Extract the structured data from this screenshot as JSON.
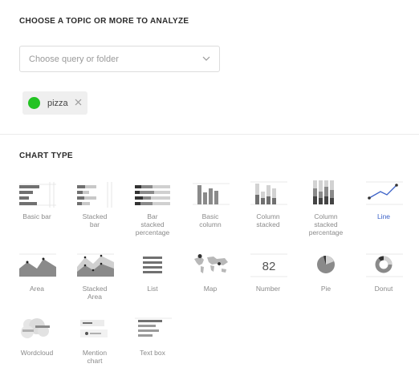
{
  "topic_section": {
    "title": "CHOOSE A TOPIC OR MORE TO ANALYZE",
    "select_placeholder": "Choose query or folder",
    "tags": [
      {
        "label": "pizza",
        "color": "#22c322"
      }
    ]
  },
  "chart_section": {
    "title": "CHART TYPE",
    "types": [
      {
        "label": "Basic bar",
        "icon": "basic-bar-icon"
      },
      {
        "label": "Stacked\nbar",
        "icon": "stacked-bar-icon"
      },
      {
        "label": "Bar\nstacked\npercentage",
        "icon": "bar-stacked-percentage-icon"
      },
      {
        "label": "Basic\ncolumn",
        "icon": "basic-column-icon"
      },
      {
        "label": "Column\nstacked",
        "icon": "column-stacked-icon"
      },
      {
        "label": "Column\nstacked\npercentage",
        "icon": "column-stacked-percentage-icon"
      },
      {
        "label": "Line",
        "icon": "line-icon",
        "selected": true
      },
      {
        "label": "Area",
        "icon": "area-icon"
      },
      {
        "label": "Stacked\nArea",
        "icon": "stacked-area-icon"
      },
      {
        "label": "List",
        "icon": "list-icon"
      },
      {
        "label": "Map",
        "icon": "map-icon"
      },
      {
        "label": "Number",
        "icon": "number-icon",
        "icon_text": "82"
      },
      {
        "label": "Pie",
        "icon": "pie-icon"
      },
      {
        "label": "Donut",
        "icon": "donut-icon"
      },
      {
        "label": "Wordcloud",
        "icon": "wordcloud-icon"
      },
      {
        "label": "Mention\nchart",
        "icon": "mention-chart-icon"
      },
      {
        "label": "Text box",
        "icon": "text-box-icon"
      }
    ]
  },
  "colors": {
    "accent": "#3c62c8",
    "tag_dot": "#22c322"
  }
}
